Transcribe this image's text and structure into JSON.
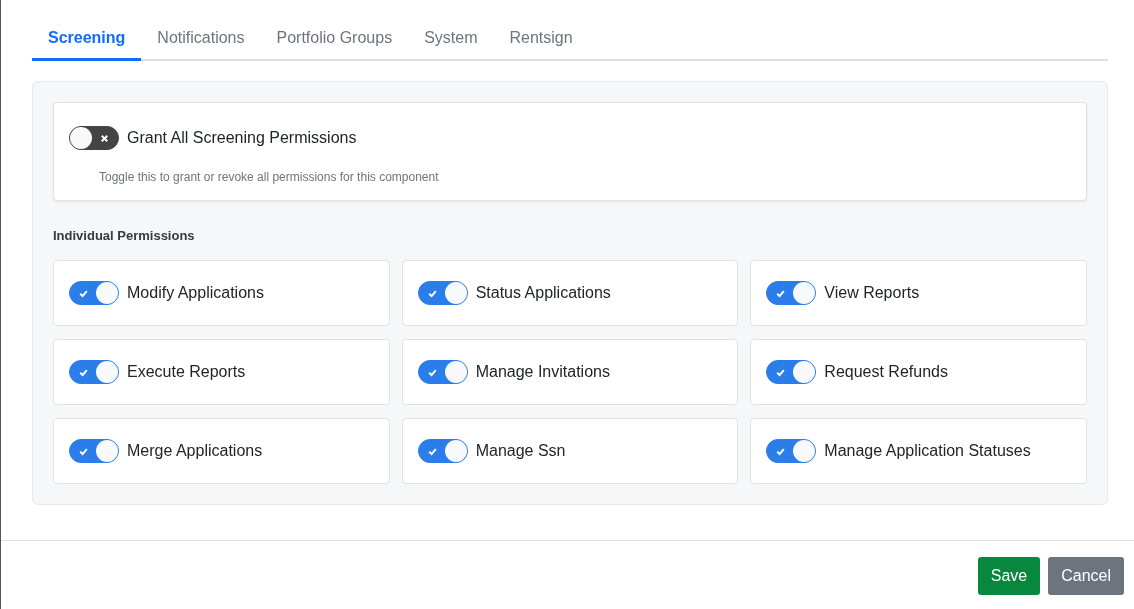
{
  "tabs": [
    {
      "label": "Screening",
      "selected": true
    },
    {
      "label": "Notifications",
      "selected": false
    },
    {
      "label": "Portfolio Groups",
      "selected": false
    },
    {
      "label": "System",
      "selected": false
    },
    {
      "label": "Rentsign",
      "selected": false
    }
  ],
  "grant_all": {
    "label": "Grant All Screening Permissions",
    "on": false,
    "help": "Toggle this to grant or revoke all permissions for this component"
  },
  "section_title": "Individual Permissions",
  "permissions": [
    {
      "label": "Modify Applications",
      "on": true
    },
    {
      "label": "Status Applications",
      "on": true
    },
    {
      "label": "View Reports",
      "on": true
    },
    {
      "label": "Execute Reports",
      "on": true
    },
    {
      "label": "Manage Invitations",
      "on": true
    },
    {
      "label": "Request Refunds",
      "on": true
    },
    {
      "label": "Merge Applications",
      "on": true
    },
    {
      "label": "Manage Ssn",
      "on": true
    },
    {
      "label": "Manage Application Statuses",
      "on": true
    }
  ],
  "buttons": [
    {
      "label": "Save",
      "kind": "primary"
    },
    {
      "label": "Cancel",
      "kind": "secondary"
    }
  ]
}
